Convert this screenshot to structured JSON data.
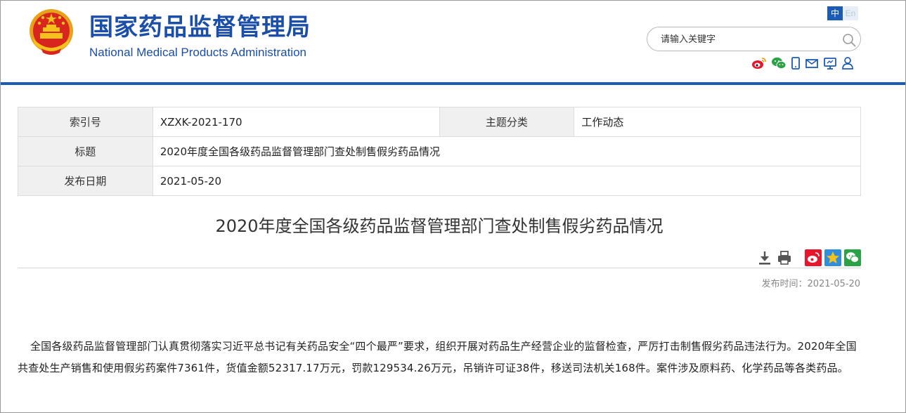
{
  "header": {
    "title_cn": "国家药品监督管理局",
    "title_en": "National Medical Products Administration",
    "lang_zh": "中",
    "lang_en": "En",
    "search_placeholder": "请输入关键字",
    "social_icons": [
      "weibo-icon",
      "wechat-icon",
      "mobile-icon",
      "mail-icon",
      "display-icon",
      "user-icon"
    ]
  },
  "meta": {
    "index_label": "索引号",
    "index_value": "XZXK-2021-170",
    "category_label": "主题分类",
    "category_value": "工作动态",
    "title_label": "标题",
    "title_value": "2020年度全国各级药品监督管理部门查处制售假劣药品情况",
    "date_label": "发布日期",
    "date_value": "2021-05-20"
  },
  "article": {
    "title": "2020年度全国各级药品监督管理部门查处制售假劣药品情况",
    "publish_time": "发布时间：2021-05-20",
    "paragraph": "全国各级药品监督管理部门认真贯彻落实习近平总书记有关药品安全“四个最严”要求，组织开展对药品生产经营企业的监督检查，严厉打击制售假劣药品违法行为。2020年全国共查处生产销售和使用假劣药案件7361件，货值金额52317.17万元，罚款129534.26万元，吊销许可证38件，移送司法机关168件。案件涉及原料药、化学药品等各类药品。",
    "tool_icons": [
      "download-icon",
      "print-icon",
      "share-weibo-icon",
      "favorite-star-icon",
      "share-wechat-icon"
    ]
  },
  "colors": {
    "brand_blue": "#1a5bb5",
    "title_blue": "#1a4ea8",
    "emblem_red": "#d8261e",
    "emblem_gold": "#f5c21b",
    "weibo_red": "#e6162d",
    "wechat_green": "#2ba245"
  }
}
